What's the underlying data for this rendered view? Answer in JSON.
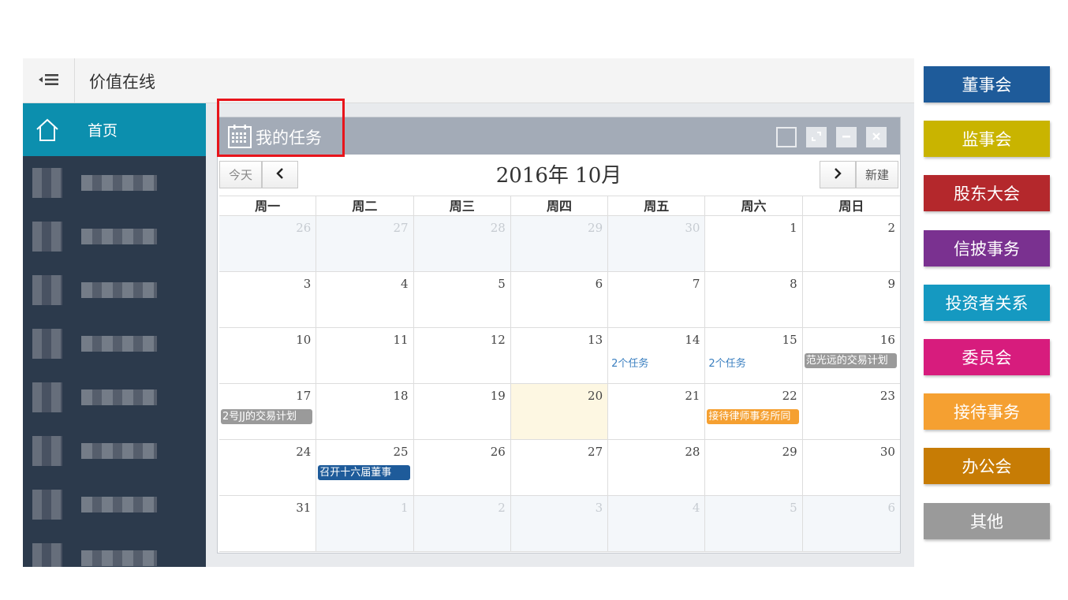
{
  "app": {
    "title": "价值在线"
  },
  "sidebar": {
    "home_label": "首页"
  },
  "panel": {
    "title": "我的任务",
    "today_label": "今天",
    "new_label": "新建",
    "month_title": "2016年  10月",
    "weekdays": [
      "周一",
      "周二",
      "周三",
      "周四",
      "周五",
      "周六",
      "周日"
    ]
  },
  "calendar": {
    "days": [
      {
        "n": "26",
        "other": true
      },
      {
        "n": "27",
        "other": true
      },
      {
        "n": "28",
        "other": true
      },
      {
        "n": "29",
        "other": true
      },
      {
        "n": "30",
        "other": true
      },
      {
        "n": "1"
      },
      {
        "n": "2"
      },
      {
        "n": "3"
      },
      {
        "n": "4"
      },
      {
        "n": "5"
      },
      {
        "n": "6"
      },
      {
        "n": "7"
      },
      {
        "n": "8"
      },
      {
        "n": "9"
      },
      {
        "n": "10"
      },
      {
        "n": "11"
      },
      {
        "n": "12"
      },
      {
        "n": "13"
      },
      {
        "n": "14",
        "link": "2个任务"
      },
      {
        "n": "15",
        "link": "2个任务"
      },
      {
        "n": "16",
        "event": "范光远的交易计划",
        "color": "#9a9a9a"
      },
      {
        "n": "17",
        "event": "2号JJ的交易计划",
        "color": "#9a9a9a"
      },
      {
        "n": "18"
      },
      {
        "n": "19"
      },
      {
        "n": "20",
        "today": true
      },
      {
        "n": "21"
      },
      {
        "n": "22",
        "event": "接待律师事务所同",
        "color": "#f5a031"
      },
      {
        "n": "23"
      },
      {
        "n": "24"
      },
      {
        "n": "25",
        "event": "召开十六届董事",
        "color": "#1e5b9a"
      },
      {
        "n": "26"
      },
      {
        "n": "27"
      },
      {
        "n": "28"
      },
      {
        "n": "29"
      },
      {
        "n": "30"
      },
      {
        "n": "31"
      },
      {
        "n": "1",
        "other": true
      },
      {
        "n": "2",
        "other": true
      },
      {
        "n": "3",
        "other": true
      },
      {
        "n": "4",
        "other": true
      },
      {
        "n": "5",
        "other": true
      },
      {
        "n": "6",
        "other": true
      }
    ]
  },
  "legend": [
    {
      "label": "董事会",
      "color": "#1e5b9a"
    },
    {
      "label": "监事会",
      "color": "#c9b400"
    },
    {
      "label": "股东大会",
      "color": "#b4282c"
    },
    {
      "label": "信披事务",
      "color": "#7a3190"
    },
    {
      "label": "投资者关系",
      "color": "#1599c1"
    },
    {
      "label": "委员会",
      "color": "#d71c7d"
    },
    {
      "label": "接待事务",
      "color": "#f5a031"
    },
    {
      "label": "办公会",
      "color": "#c77c05"
    },
    {
      "label": "其他",
      "color": "#9a9a9a"
    }
  ]
}
